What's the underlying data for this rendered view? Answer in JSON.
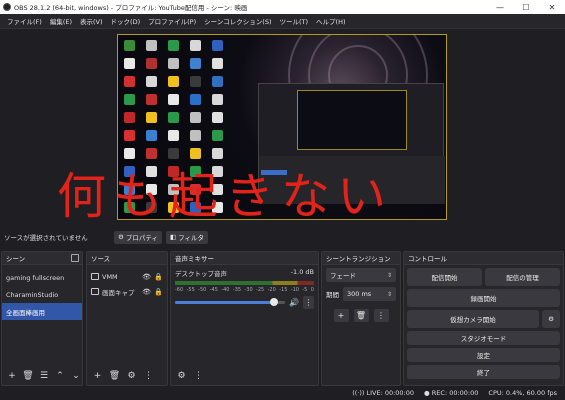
{
  "window": {
    "title": "OBS 28.1.2 (64-bit, windows) - プロファイル: YouTube配信用 - シーン: 映画",
    "minimize": "—",
    "maximize": "☐",
    "close": "✕"
  },
  "menu": [
    "ファイル(F)",
    "編集(E)",
    "表示(V)",
    "ドック(D)",
    "プロファイル(P)",
    "シーンコレクション(S)",
    "ツール(T)",
    "ヘルプ(H)"
  ],
  "overlay_text": "何も起きない",
  "source_bar": {
    "no_selection": "ソースが選択されていません",
    "properties_label": "プロパティ",
    "filters_label": "フィルタ"
  },
  "scenes": {
    "title": "シーン",
    "items": [
      {
        "label": "gaming fullscreen",
        "selected": false
      },
      {
        "label": "CharaminStudio",
        "selected": false
      },
      {
        "label": "全画面棒画用",
        "selected": true
      }
    ]
  },
  "sources": {
    "title": "ソース",
    "items": [
      {
        "label": "VMM"
      },
      {
        "label": "画面キャプ"
      }
    ]
  },
  "mixer": {
    "title": "音声ミキサー",
    "channel": "デスクトップ音声",
    "db": "-1.0 dB",
    "ticks": [
      "-60",
      "-55",
      "-50",
      "-45",
      "-40",
      "-35",
      "-30",
      "-25",
      "-20",
      "-15",
      "-10",
      "-5",
      "0"
    ],
    "volume_fraction": 0.9
  },
  "transitions": {
    "title": "シーントランジション",
    "selected": "フェード",
    "duration_label": "期間",
    "duration_value": "300 ms"
  },
  "controls": {
    "title": "コントロール",
    "start_stream": "配信開始",
    "manage_stream": "配信の管理",
    "start_recording": "録画開始",
    "virtual_cam": "仮想カメラ開始",
    "studio_mode": "スタジオモード",
    "settings": "設定",
    "exit": "終了"
  },
  "status": {
    "live": "LIVE: 00:00:00",
    "rec": "REC: 00:00:00",
    "cpu": "CPU: 0.4%, 60.00 fps"
  },
  "colors": {
    "accent": "#3357a8",
    "overlay": "#e2231a",
    "preview_border": "#b49a18"
  }
}
